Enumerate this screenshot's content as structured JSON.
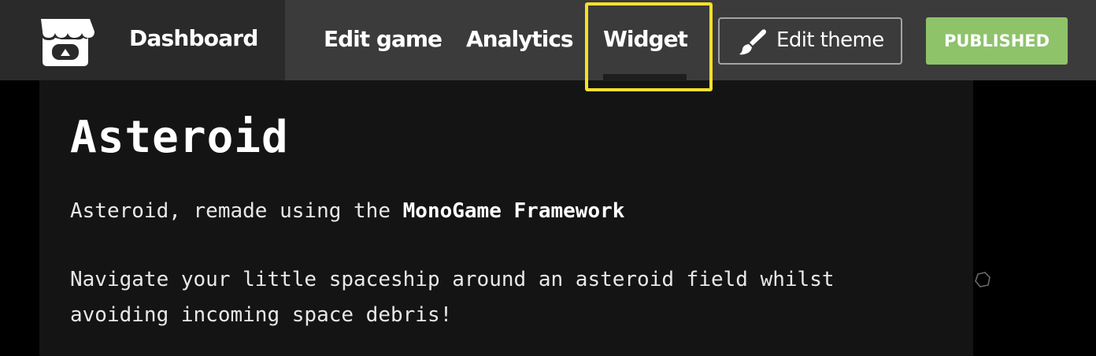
{
  "header": {
    "dashboard_label": "Dashboard",
    "nav": {
      "edit_game": "Edit game",
      "analytics": "Analytics",
      "widget": "Widget"
    },
    "edit_theme_label": "Edit theme",
    "published_label": "PUBLISHED",
    "icons": {
      "logo": "itch-io-logo-icon",
      "brush": "paintbrush-icon"
    }
  },
  "game": {
    "title": "Asteroid",
    "description_prefix": "Asteroid, remade using the ",
    "description_bold": "MonoGame Framework",
    "description_2": "Navigate your little spaceship around an asteroid field whilst\navoiding incoming space debris!"
  },
  "colors": {
    "published_green": "#8ec36a",
    "highlight_yellow": "#f5e02a",
    "bar_dark": "#2a2a2a",
    "bar_light": "#3b3b3b",
    "content_bg": "#141414"
  }
}
